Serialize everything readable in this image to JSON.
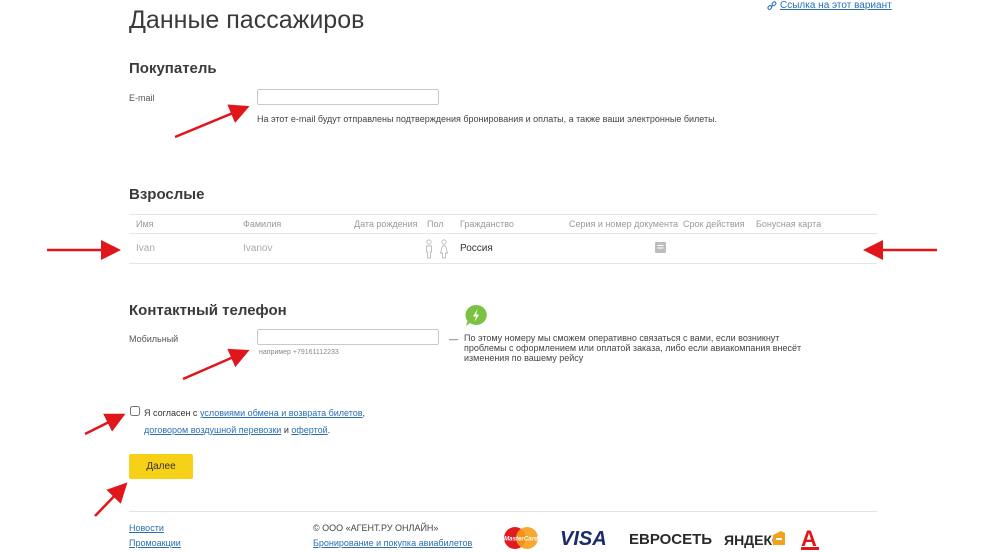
{
  "page": {
    "title": "Данные пассажиров",
    "share_link": "Ссылка на этот вариант"
  },
  "buyer": {
    "heading": "Покупатель",
    "email_label": "E-mail",
    "email_value": "",
    "email_hint": "На этот e-mail будут отправлены подтверждения бронирования и оплаты, а также ваши электронные билеты."
  },
  "adults": {
    "heading": "Взрослые",
    "columns": [
      "Имя",
      "Фамилия",
      "Дата рождения",
      "Пол",
      "Гражданство",
      "Серия и номер документа",
      "Срок действия",
      "Бонусная карта"
    ],
    "row": {
      "first_name": "Ivan",
      "last_name": "Ivanov",
      "birth_date": "",
      "citizenship": "Россия"
    }
  },
  "contact": {
    "heading": "Контактный телефон",
    "mobile_label": "Мобильный",
    "mobile_value": "",
    "mobile_example": "например +79161112233",
    "dash": "—",
    "note": "По этому номеру мы сможем оперативно связаться с вами, если возникнут проблемы с оформлением или оплатой заказа, либо если авиакомпания внесёт изменения по вашему рейсу"
  },
  "agree": {
    "prefix": "Я согласен с",
    "link1": "условиями обмена и возврата билетов",
    "sep1": ",",
    "link2": "договором воздушной перевозки",
    "and": "и",
    "link3": "офертой",
    "end": "."
  },
  "next_button": "Далее",
  "footer": {
    "news": "Новости",
    "promo": "Промоакции",
    "company": "© ООО «АГЕНТ.РУ ОНЛАЙН»",
    "company_link": "Бронирование и покупка авиабилетов",
    "logos": {
      "mastercard": "MasterCard",
      "visa": "VISA",
      "evroset": "ЕВРОСЕТЬ",
      "yandex": "ЯНДЕКС",
      "alfa": "А"
    }
  },
  "colors": {
    "accent_yellow": "#f7d117",
    "link_blue": "#2a6fb5",
    "arrow_red": "#e0161b",
    "chat_green": "#7cc242"
  }
}
